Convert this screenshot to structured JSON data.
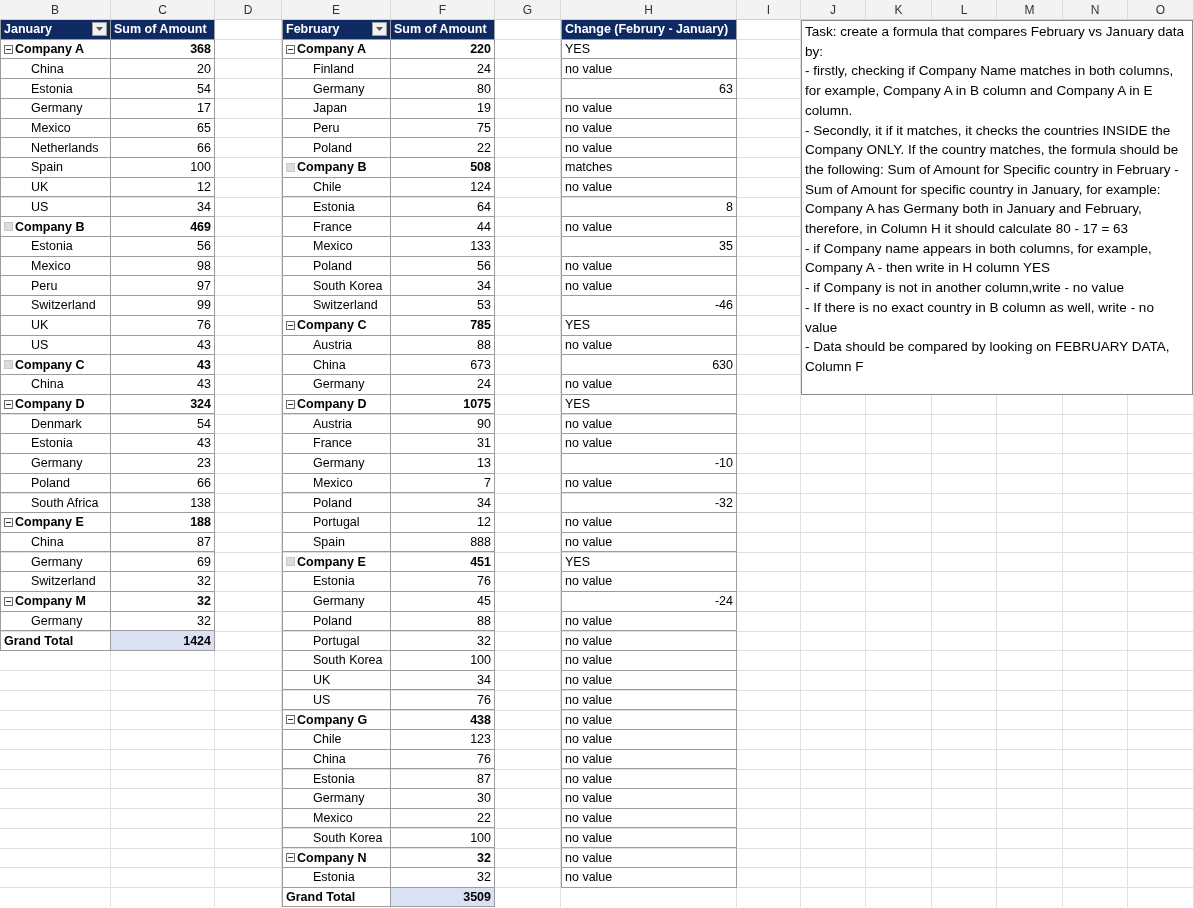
{
  "columns": [
    "B",
    "C",
    "D",
    "E",
    "F",
    "G",
    "H",
    "I",
    "J",
    "K",
    "L",
    "M",
    "N",
    "O"
  ],
  "january": {
    "row_header": "January",
    "value_header": "Sum of Amount",
    "groups": [
      {
        "name": "Company A",
        "total": "368",
        "kind": "minus",
        "items": [
          {
            "name": "China",
            "value": "20"
          },
          {
            "name": "Estonia",
            "value": "54"
          },
          {
            "name": "Germany",
            "value": "17"
          },
          {
            "name": "Mexico",
            "value": "65"
          },
          {
            "name": "Netherlands",
            "value": "66"
          },
          {
            "name": "Spain",
            "value": "100"
          },
          {
            "name": "UK",
            "value": "12"
          },
          {
            "name": "US",
            "value": "34"
          }
        ]
      },
      {
        "name": "Company B",
        "total": "469",
        "kind": "blank",
        "items": [
          {
            "name": "Estonia",
            "value": "56"
          },
          {
            "name": "Mexico",
            "value": "98"
          },
          {
            "name": "Peru",
            "value": "97"
          },
          {
            "name": "Switzerland",
            "value": "99"
          },
          {
            "name": "UK",
            "value": "76"
          },
          {
            "name": "US",
            "value": "43"
          }
        ]
      },
      {
        "name": "Company C",
        "total": "43",
        "kind": "blank",
        "items": [
          {
            "name": "China",
            "value": "43"
          }
        ]
      },
      {
        "name": "Company D",
        "total": "324",
        "kind": "minus",
        "items": [
          {
            "name": "Denmark",
            "value": "54"
          },
          {
            "name": "Estonia",
            "value": "43"
          },
          {
            "name": "Germany",
            "value": "23"
          },
          {
            "name": "Poland",
            "value": "66"
          },
          {
            "name": "South Africa",
            "value": "138"
          }
        ]
      },
      {
        "name": "Company E",
        "total": "188",
        "kind": "minus",
        "items": [
          {
            "name": "China",
            "value": "87"
          },
          {
            "name": "Germany",
            "value": "69"
          },
          {
            "name": "Switzerland",
            "value": "32"
          }
        ]
      },
      {
        "name": "Company M",
        "total": "32",
        "kind": "minus",
        "items": [
          {
            "name": "Germany",
            "value": "32"
          }
        ]
      }
    ],
    "grand_total": {
      "label": "Grand Total",
      "value": "1424"
    }
  },
  "february": {
    "row_header": "February",
    "value_header": "Sum of Amount",
    "groups": [
      {
        "name": "Company A",
        "total": "220",
        "kind": "minus",
        "items": [
          {
            "name": "Finland",
            "value": "24"
          },
          {
            "name": "Germany",
            "value": "80"
          },
          {
            "name": "Japan",
            "value": "19"
          },
          {
            "name": "Peru",
            "value": "75"
          },
          {
            "name": "Poland",
            "value": "22"
          }
        ]
      },
      {
        "name": "Company B",
        "total": "508",
        "kind": "blank",
        "items": [
          {
            "name": "Chile",
            "value": "124"
          },
          {
            "name": "Estonia",
            "value": "64"
          },
          {
            "name": "France",
            "value": "44"
          },
          {
            "name": "Mexico",
            "value": "133"
          },
          {
            "name": "Poland",
            "value": "56"
          },
          {
            "name": "South Korea",
            "value": "34"
          },
          {
            "name": "Switzerland",
            "value": "53"
          }
        ]
      },
      {
        "name": "Company C",
        "total": "785",
        "kind": "minus",
        "items": [
          {
            "name": "Austria",
            "value": "88"
          },
          {
            "name": "China",
            "value": "673"
          },
          {
            "name": "Germany",
            "value": "24"
          }
        ]
      },
      {
        "name": "Company D",
        "total": "1075",
        "kind": "minus",
        "items": [
          {
            "name": "Austria",
            "value": "90"
          },
          {
            "name": "France",
            "value": "31"
          },
          {
            "name": "Germany",
            "value": "13"
          },
          {
            "name": "Mexico",
            "value": "7"
          },
          {
            "name": "Poland",
            "value": "34"
          },
          {
            "name": "Portugal",
            "value": "12"
          },
          {
            "name": "Spain",
            "value": "888"
          }
        ]
      },
      {
        "name": "Company E",
        "total": "451",
        "kind": "blank",
        "items": [
          {
            "name": "Estonia",
            "value": "76"
          },
          {
            "name": "Germany",
            "value": "45"
          },
          {
            "name": "Poland",
            "value": "88"
          },
          {
            "name": "Portugal",
            "value": "32"
          },
          {
            "name": "South Korea",
            "value": "100"
          },
          {
            "name": "UK",
            "value": "34"
          },
          {
            "name": "US",
            "value": "76"
          }
        ]
      },
      {
        "name": "Company G",
        "total": "438",
        "kind": "minus",
        "items": [
          {
            "name": "Chile",
            "value": "123"
          },
          {
            "name": "China",
            "value": "76"
          },
          {
            "name": "Estonia",
            "value": "87"
          },
          {
            "name": "Germany",
            "value": "30"
          },
          {
            "name": "Mexico",
            "value": "22"
          },
          {
            "name": "South Korea",
            "value": "100"
          }
        ]
      },
      {
        "name": "Company N",
        "total": "32",
        "kind": "minus",
        "items": [
          {
            "name": "Estonia",
            "value": "32"
          }
        ]
      }
    ],
    "grand_total": {
      "label": "Grand Total",
      "value": "3509"
    }
  },
  "change": {
    "header": "Change (Februry - January)",
    "values": [
      {
        "text": "YES",
        "kind": "text"
      },
      {
        "text": "no value",
        "kind": "text"
      },
      {
        "text": "63",
        "kind": "number"
      },
      {
        "text": "no value",
        "kind": "text"
      },
      {
        "text": "no value",
        "kind": "text"
      },
      {
        "text": "no value",
        "kind": "text"
      },
      {
        "text": "matches",
        "kind": "text"
      },
      {
        "text": "no value",
        "kind": "text"
      },
      {
        "text": "8",
        "kind": "number"
      },
      {
        "text": "no value",
        "kind": "text"
      },
      {
        "text": "35",
        "kind": "number"
      },
      {
        "text": "no value",
        "kind": "text"
      },
      {
        "text": "no value",
        "kind": "text"
      },
      {
        "text": "-46",
        "kind": "number"
      },
      {
        "text": "YES",
        "kind": "text"
      },
      {
        "text": "no value",
        "kind": "text"
      },
      {
        "text": "630",
        "kind": "number"
      },
      {
        "text": "no value",
        "kind": "text"
      },
      {
        "text": "YES",
        "kind": "text"
      },
      {
        "text": "no value",
        "kind": "text"
      },
      {
        "text": "no value",
        "kind": "text"
      },
      {
        "text": "-10",
        "kind": "number"
      },
      {
        "text": "no value",
        "kind": "text"
      },
      {
        "text": "-32",
        "kind": "number"
      },
      {
        "text": "no value",
        "kind": "text"
      },
      {
        "text": "no value",
        "kind": "text"
      },
      {
        "text": "YES",
        "kind": "text"
      },
      {
        "text": "no value",
        "kind": "text"
      },
      {
        "text": "-24",
        "kind": "number"
      },
      {
        "text": "no value",
        "kind": "text"
      },
      {
        "text": "no value",
        "kind": "text"
      },
      {
        "text": "no value",
        "kind": "text"
      },
      {
        "text": "no value",
        "kind": "text"
      },
      {
        "text": "no value",
        "kind": "text"
      },
      {
        "text": "no value",
        "kind": "text"
      },
      {
        "text": "no value",
        "kind": "text"
      },
      {
        "text": "no value",
        "kind": "text"
      },
      {
        "text": "no value",
        "kind": "text"
      },
      {
        "text": "no value",
        "kind": "text"
      },
      {
        "text": "no value",
        "kind": "text"
      },
      {
        "text": "no value",
        "kind": "text"
      },
      {
        "text": "no value",
        "kind": "text"
      },
      {
        "text": "no value",
        "kind": "text"
      }
    ]
  },
  "task_note": {
    "paragraphs": [
      "Task: create a formula that compares February vs January data by:",
      "- firstly, checking if Company Name matches in both columns, for example, Company A in B column and Company A in E column.",
      "- Secondly, it if it matches, it checks the countries INSIDE the Company ONLY. If the country matches, the formula should be the following: Sum of Amount for Specific country in February - Sum of Amount for specific country in January, for example:",
      "Company A has Germany both in January and February, therefore, in Column H it should calculate 80 - 17 = 63",
      "- if Company name appears in both columns, for example, Company A - then write in H column YES",
      "- if Company is not in another column,write - no value",
      "- If there is no exact country in B column as well, write - no value",
      "- Data should be compared by looking on FEBRUARY DATA, Column F"
    ]
  }
}
